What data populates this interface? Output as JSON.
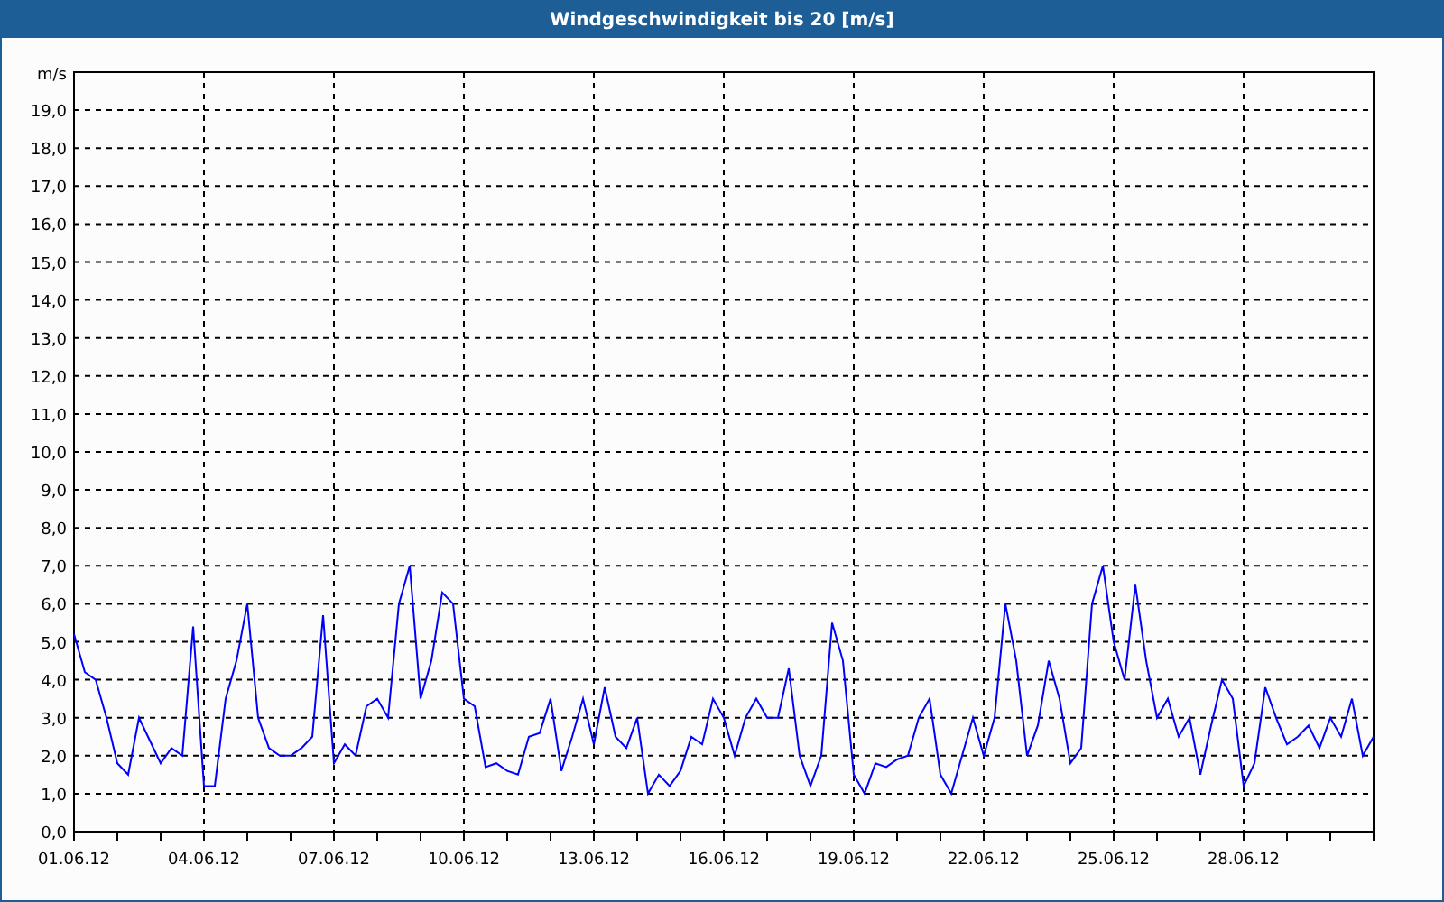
{
  "window": {
    "title": "Windgeschwindigkeit bis 20 [m/s]"
  },
  "chart": {
    "chart_data": {
      "type": "line",
      "grid": true,
      "ylabel": "m/s",
      "ylim": [
        0,
        20
      ],
      "yticks": [
        {
          "value": 0,
          "label": "0,0"
        },
        {
          "value": 1,
          "label": "1,0"
        },
        {
          "value": 2,
          "label": "2,0"
        },
        {
          "value": 3,
          "label": "3,0"
        },
        {
          "value": 4,
          "label": "4,0"
        },
        {
          "value": 5,
          "label": "5,0"
        },
        {
          "value": 6,
          "label": "6,0"
        },
        {
          "value": 7,
          "label": "7,0"
        },
        {
          "value": 8,
          "label": "8,0"
        },
        {
          "value": 9,
          "label": "9,0"
        },
        {
          "value": 10,
          "label": "10,0"
        },
        {
          "value": 11,
          "label": "11,0"
        },
        {
          "value": 12,
          "label": "12,0"
        },
        {
          "value": 13,
          "label": "13,0"
        },
        {
          "value": 14,
          "label": "14,0"
        },
        {
          "value": 15,
          "label": "15,0"
        },
        {
          "value": 16,
          "label": "16,0"
        },
        {
          "value": 17,
          "label": "17,0"
        },
        {
          "value": 18,
          "label": "18,0"
        },
        {
          "value": 19,
          "label": "19,0"
        }
      ],
      "categories": [
        "01.06.12",
        null,
        null,
        null,
        null,
        null,
        null,
        null,
        null,
        null,
        null,
        null,
        "04.06.12",
        null,
        null,
        null,
        null,
        null,
        null,
        null,
        null,
        null,
        null,
        null,
        "07.06.12",
        null,
        null,
        null,
        null,
        null,
        null,
        null,
        null,
        null,
        null,
        null,
        "10.06.12",
        null,
        null,
        null,
        null,
        null,
        null,
        null,
        null,
        null,
        null,
        null,
        "13.06.12",
        null,
        null,
        null,
        null,
        null,
        null,
        null,
        null,
        null,
        null,
        null,
        "16.06.12",
        null,
        null,
        null,
        null,
        null,
        null,
        null,
        null,
        null,
        null,
        null,
        "19.06.12",
        null,
        null,
        null,
        null,
        null,
        null,
        null,
        null,
        null,
        null,
        null,
        "22.06.12",
        null,
        null,
        null,
        null,
        null,
        null,
        null,
        null,
        null,
        null,
        null,
        "25.06.12",
        null,
        null,
        null,
        null,
        null,
        null,
        null,
        null,
        null,
        null,
        null,
        "28.06.12",
        null,
        null,
        null,
        null,
        null,
        null,
        null,
        null,
        null,
        null,
        null,
        null
      ],
      "series": [
        {
          "color": "#0000ff",
          "values": [
            5.2,
            4.2,
            4.0,
            3.0,
            1.8,
            1.5,
            3.0,
            2.4,
            1.8,
            2.2,
            2.0,
            5.4,
            1.2,
            1.2,
            3.5,
            4.5,
            6.0,
            3.0,
            2.2,
            2.0,
            2.0,
            2.2,
            2.5,
            5.7,
            1.8,
            2.3,
            2.0,
            3.3,
            3.5,
            3.0,
            6.0,
            7.0,
            3.5,
            4.5,
            6.3,
            6.0,
            3.5,
            3.3,
            1.7,
            1.8,
            1.6,
            1.5,
            2.5,
            2.6,
            3.5,
            1.6,
            2.5,
            3.5,
            2.3,
            3.8,
            2.5,
            2.2,
            3.0,
            1.0,
            1.5,
            1.2,
            1.6,
            2.5,
            2.3,
            3.5,
            3.0,
            2.0,
            3.0,
            3.5,
            3.0,
            3.0,
            4.3,
            2.0,
            1.2,
            2.0,
            5.5,
            4.5,
            1.5,
            1.0,
            1.8,
            1.7,
            1.9,
            2.0,
            3.0,
            3.5,
            1.5,
            1.0,
            2.0,
            3.0,
            2.0,
            3.0,
            6.0,
            4.5,
            2.0,
            2.8,
            4.5,
            3.5,
            1.8,
            2.2,
            6.0,
            7.0,
            5.0,
            4.0,
            6.5,
            4.5,
            3.0,
            3.5,
            2.5,
            3.0,
            1.5,
            2.8,
            4.0,
            3.5,
            1.2,
            1.8,
            3.8,
            3.0,
            2.3,
            2.5,
            2.8,
            2.2,
            3.0,
            2.5,
            3.5,
            2.0,
            2.5
          ]
        }
      ]
    }
  }
}
